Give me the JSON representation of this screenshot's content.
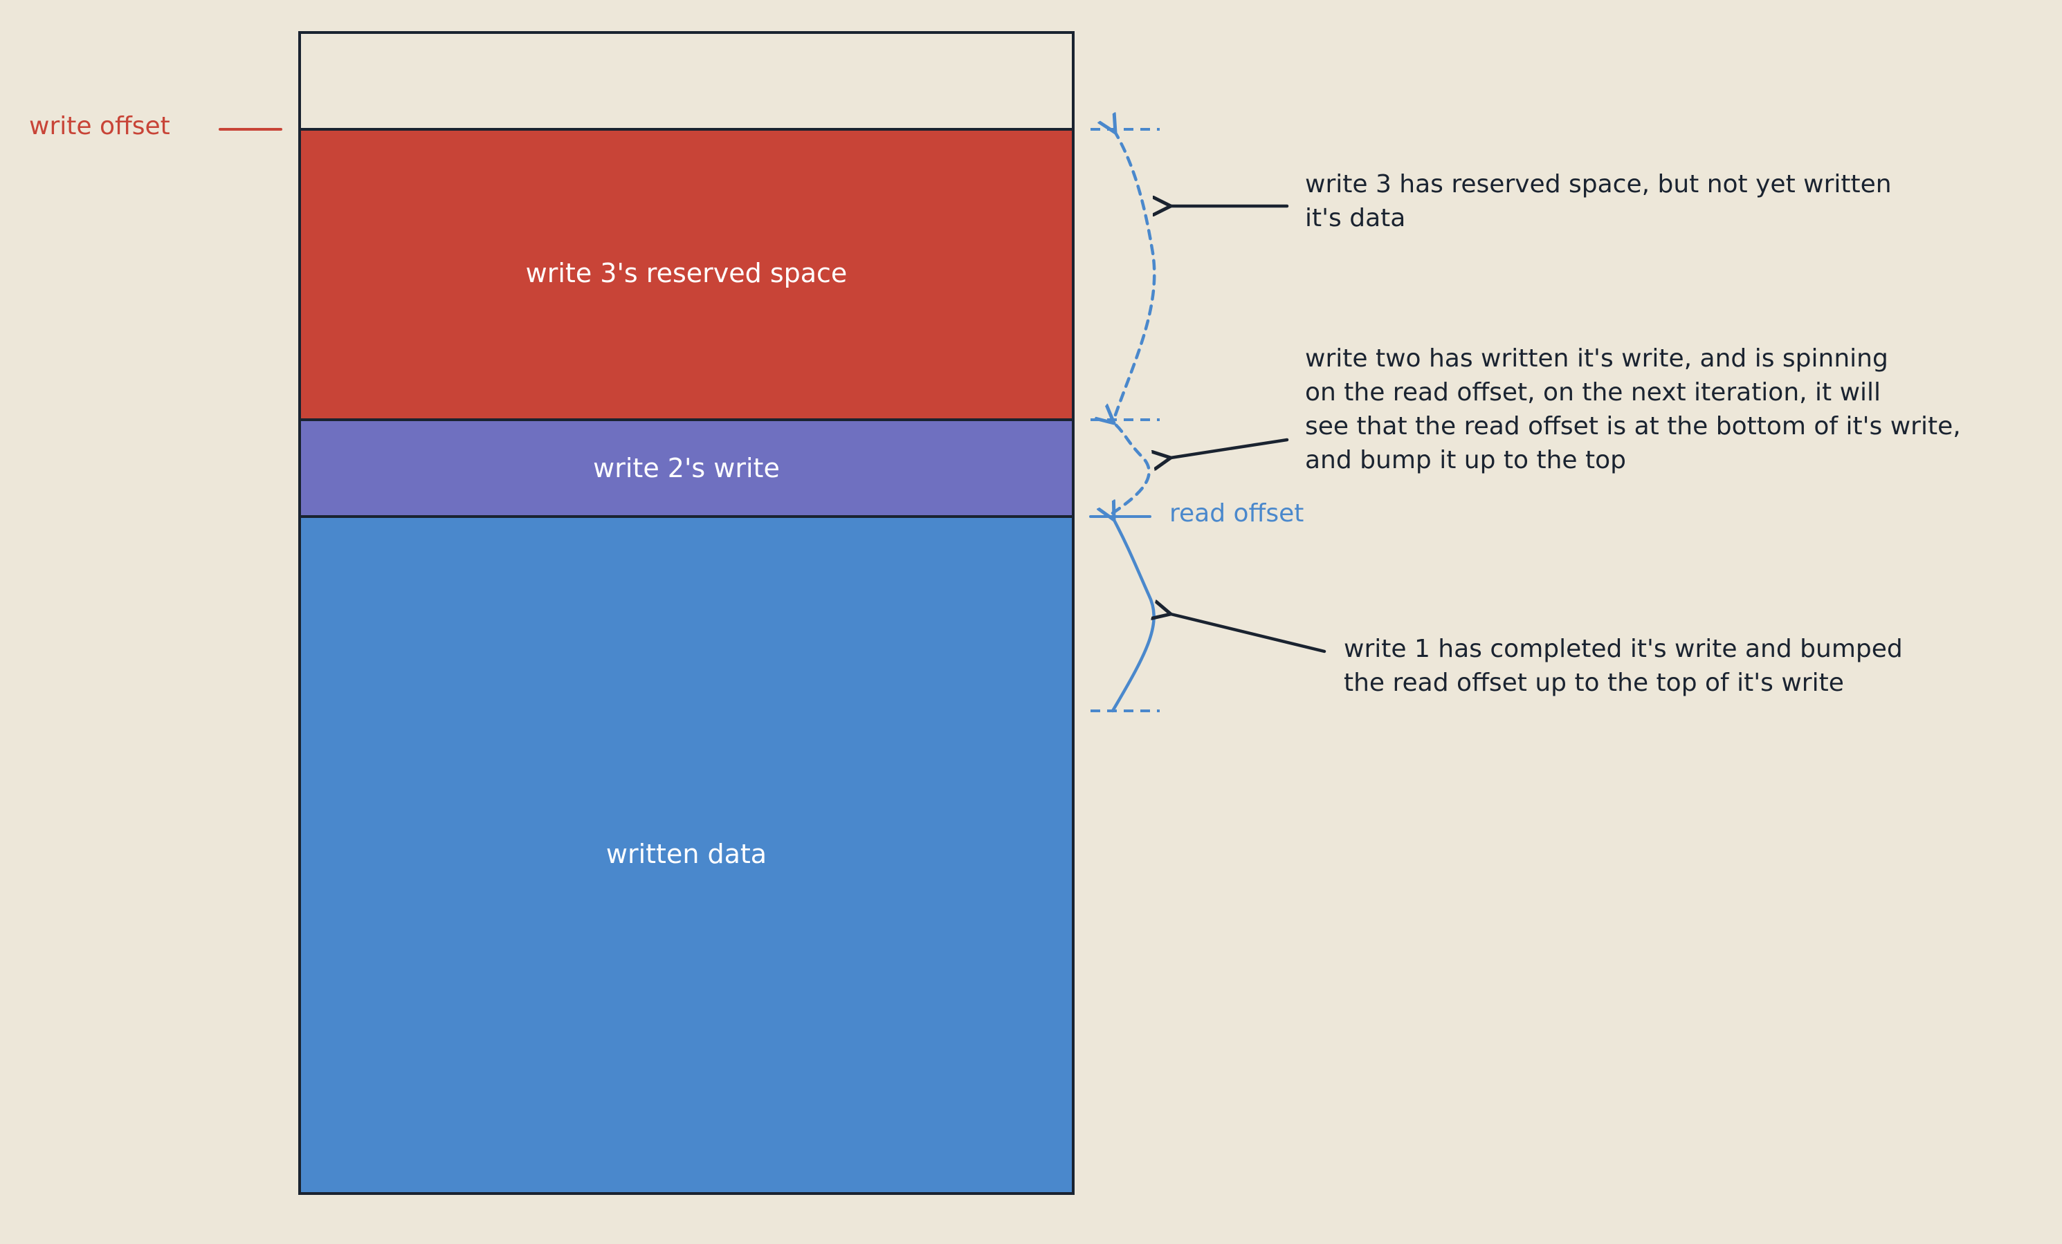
{
  "colors": {
    "background": "#ede7d9",
    "outline": "#1a2330",
    "reserved": "#c84437",
    "write2": "#6f70c0",
    "written": "#4a88cc",
    "write_offset": "#c84437",
    "read_offset": "#4a88cc",
    "annotation": "#1a2330"
  },
  "buffer": {
    "reserved_label": "write 3's reserved space",
    "write2_label": "write 2's write",
    "written_label": "written data"
  },
  "markers": {
    "write_offset": "write offset",
    "read_offset": "read offset"
  },
  "notes": {
    "write3": [
      "write 3 has reserved space, but not yet written",
      "it's data"
    ],
    "write2": [
      "write two has written it's write, and is spinning",
      "on the read offset, on the next iteration, it will",
      "see that the read offset is at the bottom of it's write,",
      "and bump it up to the top"
    ],
    "write1": [
      "write 1 has completed it's write and bumped",
      "the read offset up to the top of it's write"
    ]
  }
}
